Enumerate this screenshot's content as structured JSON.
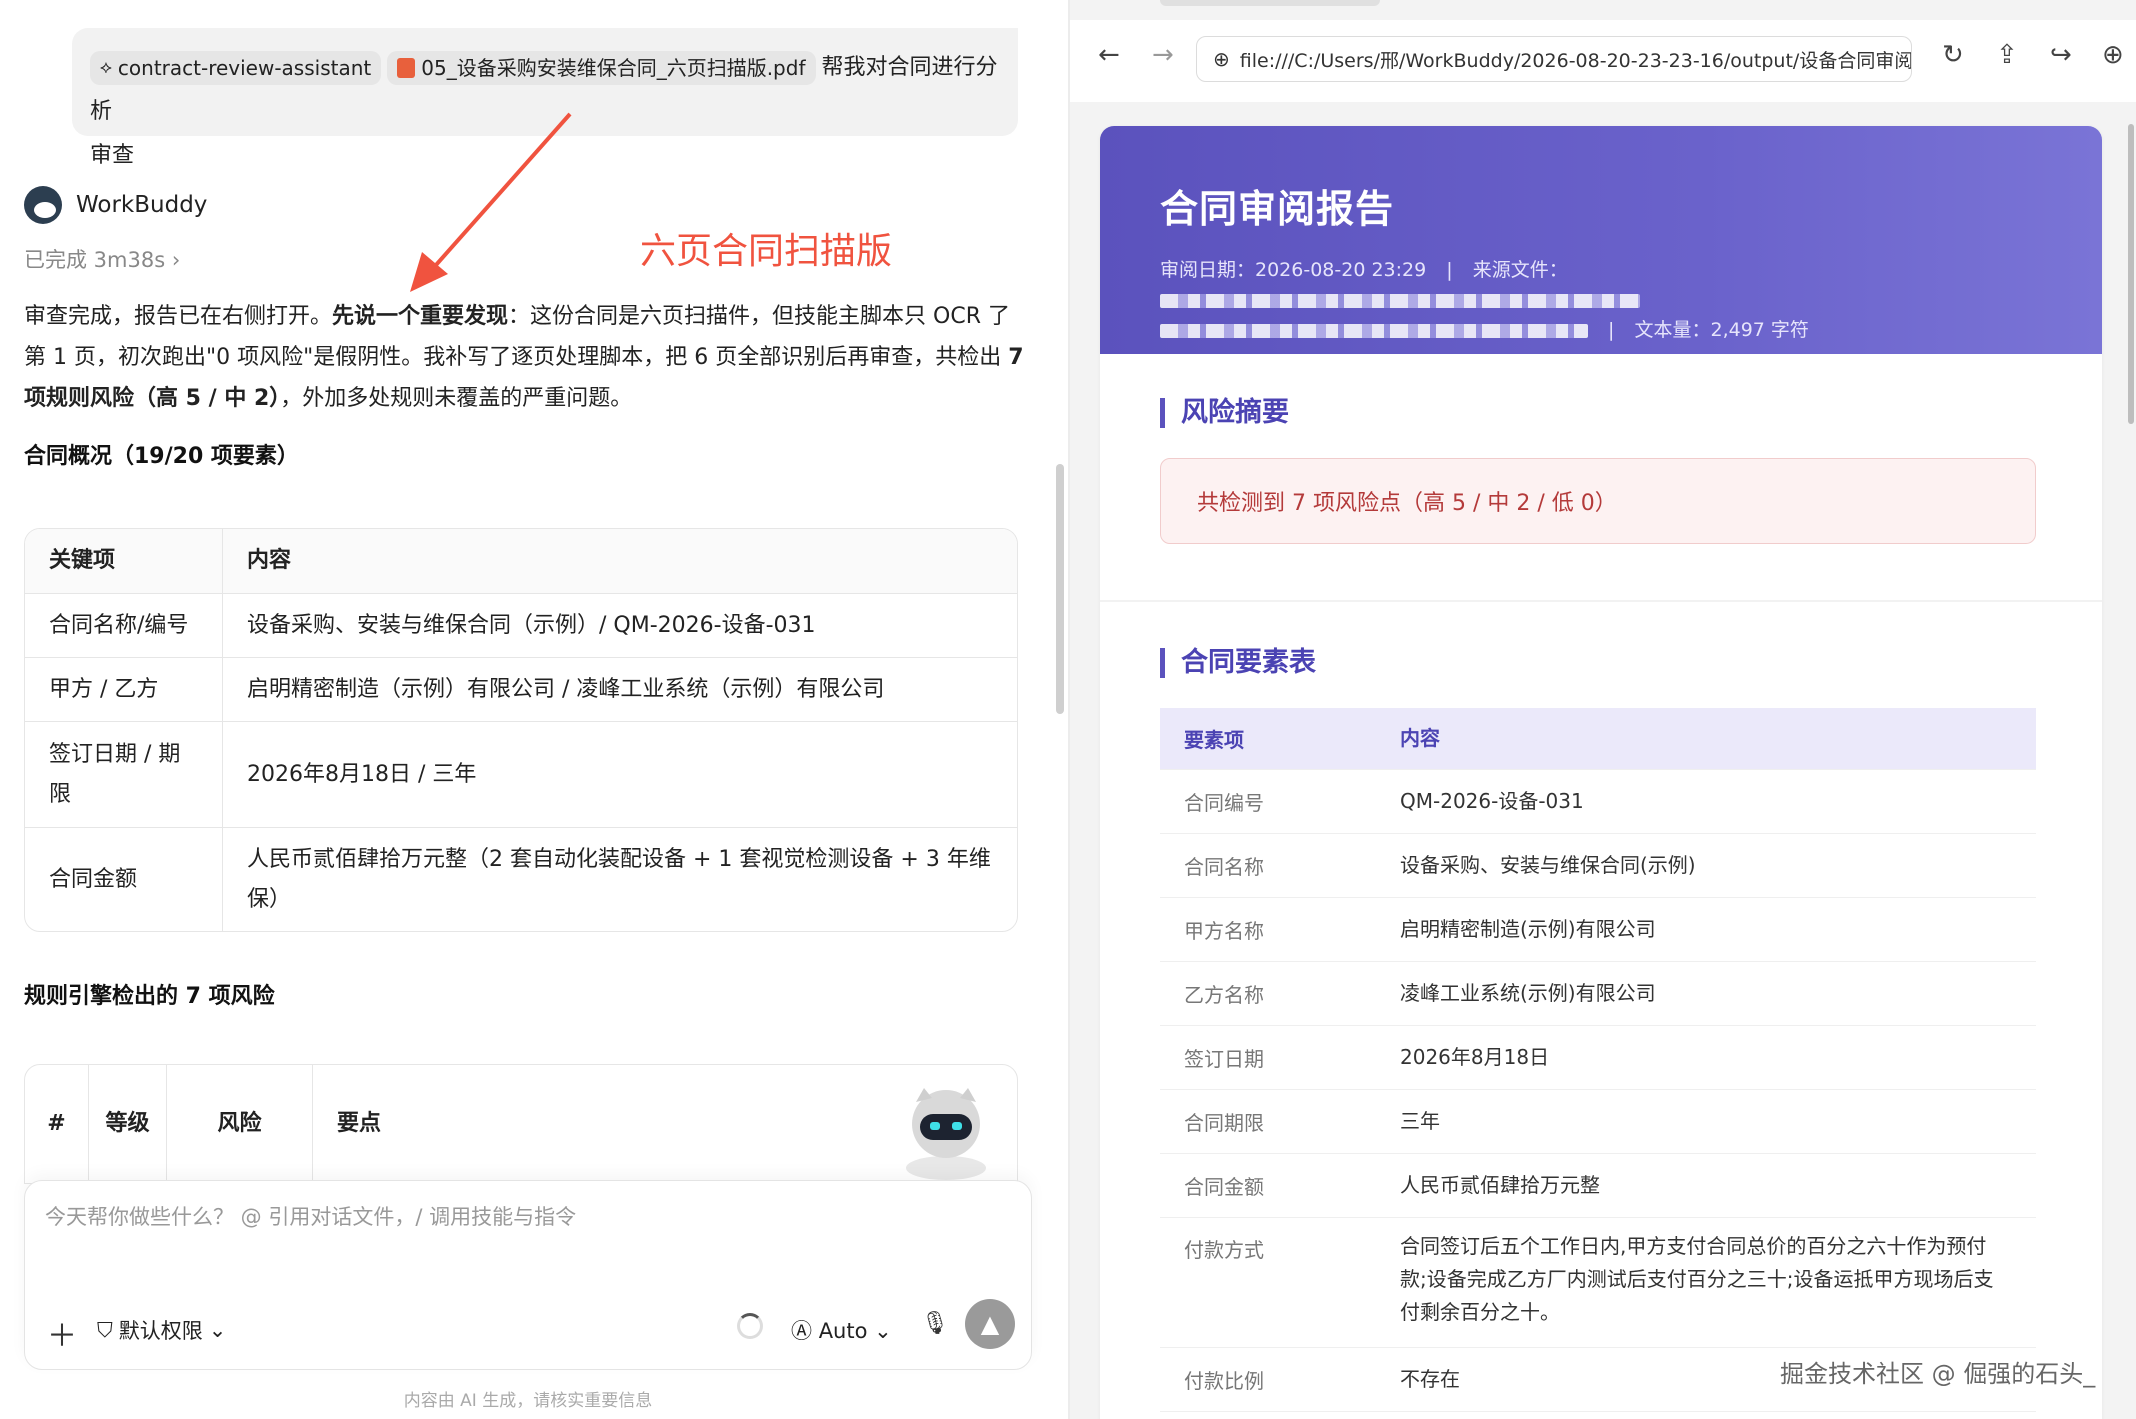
{
  "chat": {
    "user_message": {
      "skill_chip": "contract-review-assistant",
      "file_chip": "05_设备采购安装维保合同_六页扫描版.pdf",
      "text_line1": "帮我对合同进行分析",
      "text_line2": "审查"
    },
    "agent": {
      "name": "WorkBuddy",
      "status": "已完成 3m38s",
      "para_a": "审查完成，报告已在右侧打开。",
      "para_b": "先说一个重要发现",
      "para_c": "：这份合同是六页扫描件，但技能主脚本只 OCR 了第 1 页，初次跑出\"0 项风险\"是假阴性。我补写了逐页处理脚本，把 6 页全部识别后再审查，共检出 ",
      "para_d": "7 项规则风险（高 5 / 中 2）",
      "para_e": "，外加多处规则未覆盖的严重问题。"
    },
    "annotation": "六页合同扫描版",
    "overview_title": "合同概况（19/20 项要素）",
    "overview_table": {
      "headers": [
        "关键项",
        "内容"
      ],
      "rows": [
        [
          "合同名称/编号",
          "设备采购、安装与维保合同（示例）/ QM-2026-设备-031"
        ],
        [
          "甲方 / 乙方",
          "启明精密制造（示例）有限公司 / 凌峰工业系统（示例）有限公司"
        ],
        [
          "签订日期 / 期限",
          "2026年8月18日 / 三年"
        ],
        [
          "合同金额",
          "人民币贰佰肆拾万元整（2 套自动化装配设备 + 1 套视觉检测设备 + 3 年维保）"
        ]
      ]
    },
    "risk_title": "规则引擎检出的 7 项风险",
    "risk_table_headers": [
      "#",
      "等级",
      "风险",
      "要点"
    ],
    "composer": {
      "placeholder": "今天帮你做些什么？ @ 引用对话文件，/ 调用技能与指令",
      "permission": "默认权限",
      "model": "Auto"
    },
    "disclaimer": "内容由 AI 生成，请核实重要信息"
  },
  "browser": {
    "url": "file:///C:/Users/邢/WorkBuddy/2026-08-20-23-23-16/output/设备合同审阅",
    "report": {
      "title": "合同审阅报告",
      "date_label": "审阅日期：2026-08-20 23:29",
      "source_label": "来源文件：",
      "char_count": "文本量：2,497 字符",
      "risk_summary_title": "风险摘要",
      "risk_summary_text": "共检测到 7 项风险点（高 5 / 中 2 / 低 0）",
      "elements_title": "合同要素表",
      "elements_headers": [
        "要素项",
        "内容"
      ],
      "elements_rows": [
        [
          "合同编号",
          "QM-2026-设备-031"
        ],
        [
          "合同名称",
          "设备采购、安装与维保合同(示例)"
        ],
        [
          "甲方名称",
          "启明精密制造(示例)有限公司"
        ],
        [
          "乙方名称",
          "凌峰工业系统(示例)有限公司"
        ],
        [
          "签订日期",
          "2026年8月18日"
        ],
        [
          "合同期限",
          "三年"
        ],
        [
          "合同金额",
          "人民币贰佰肆拾万元整"
        ],
        [
          "付款方式",
          "合同签订后五个工作日内,甲方支付合同总价的百分之六十作为预付款;设备完成乙方厂内测试后支付百分之三十;设备运抵甲方现场后支付剩余百分之十。"
        ],
        [
          "付款比例",
          "不存在"
        ]
      ]
    }
  },
  "watermark": "掘金技术社区 @ 倔强的石头_"
}
